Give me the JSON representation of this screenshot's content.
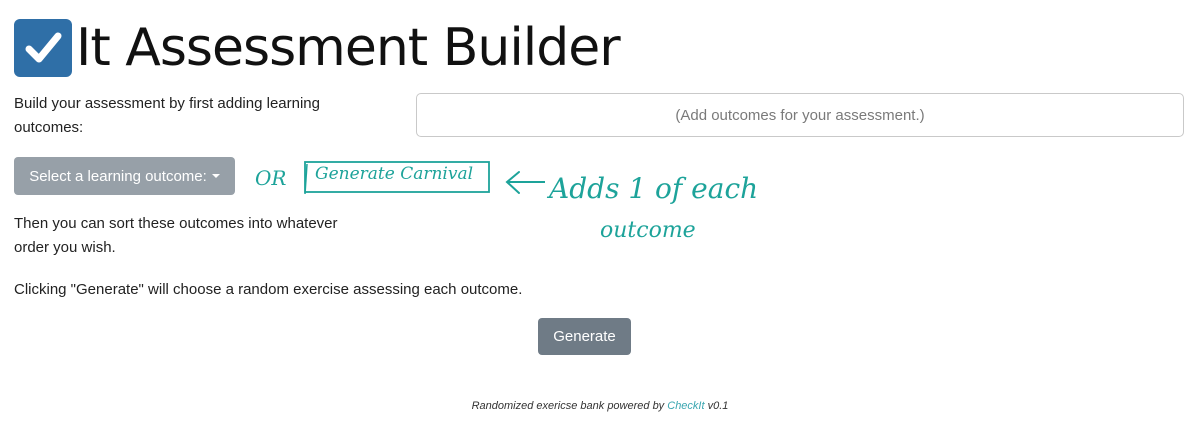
{
  "header": {
    "title": "It Assessment Builder",
    "icon": "checkbox-icon",
    "icon_color": "#2f6fa7"
  },
  "instructions": {
    "intro": "Build your assessment by first adding learning outcomes:",
    "sort": "Then you can sort these outcomes into whatever order you wish.",
    "generate": "Clicking \"Generate\" will choose a random exercise assessing each outcome."
  },
  "outcomes_box": {
    "placeholder": "(Add outcomes for your assessment.)"
  },
  "select_outcome": {
    "label": "Select a learning outcome:"
  },
  "generate_button": {
    "label": "Generate"
  },
  "annotation": {
    "or": "OR",
    "button_sketch": "Generate Carnival",
    "note_line1": "Adds 1 of each",
    "note_line2": "outcome",
    "color": "#1da39a"
  },
  "footer": {
    "prefix": "Randomized exericse bank powered by",
    "link": "CheckIt",
    "version": "v0.1",
    "link_color": "#3aa6b0"
  }
}
